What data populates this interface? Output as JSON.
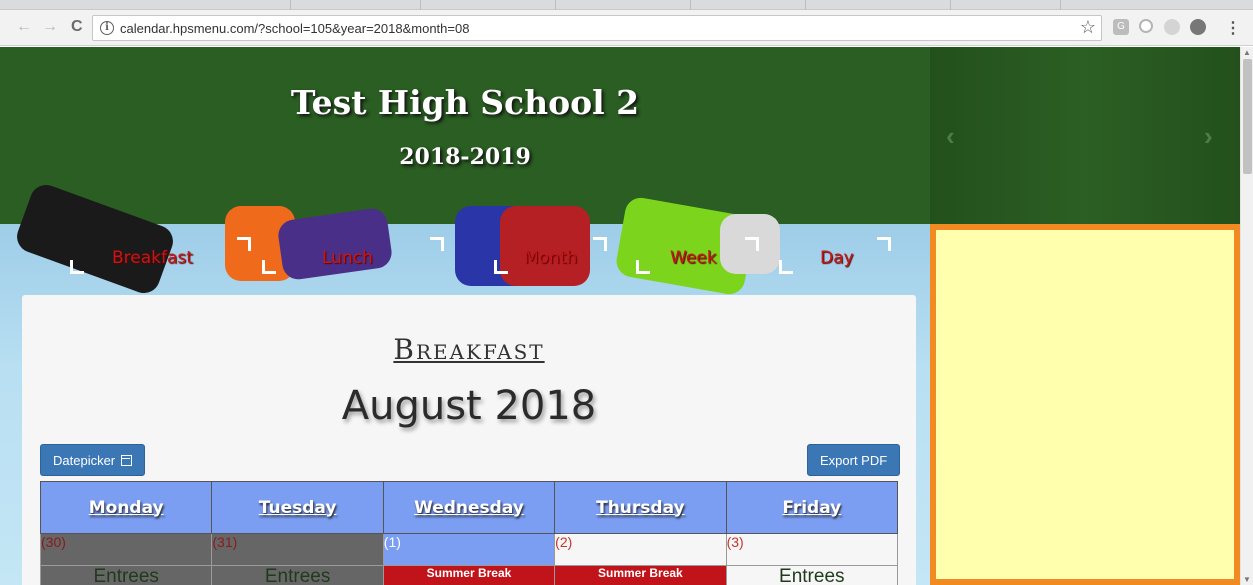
{
  "browser": {
    "url": "calendar.hpsmenu.com/?school=105&year=2018&month=08",
    "back_icon": "←",
    "forward_icon": "→",
    "reload_icon": "C",
    "info_icon": "i",
    "star_icon": "☆",
    "menu_icon": "⋮"
  },
  "header": {
    "school_name": "Test High School 2",
    "school_year": "2018-2019",
    "prev_arrow": "‹",
    "next_arrow": "›"
  },
  "tabs": [
    "Breakfast",
    "Lunch",
    "Month",
    "Week",
    "Day"
  ],
  "calendar": {
    "meal": "Breakfast",
    "month_title": "August 2018",
    "datepicker_label": "Datepicker",
    "export_label": "Export PDF",
    "days": [
      "Monday",
      "Tuesday",
      "Wednesday",
      "Thursday",
      "Friday"
    ],
    "day_numbers": [
      "(30)",
      "(31)",
      "(1)",
      "(2)",
      "(3)"
    ],
    "entries": [
      "Entrees",
      "Entrees",
      "Summer Break",
      "Summer Break",
      "Entrees"
    ]
  },
  "colors": {
    "header_green": "#2a5e22",
    "day_header_blue": "#7b9ef3",
    "break_red": "#c0141a",
    "side_border_orange": "#f28a22",
    "side_fill_yellow": "#ffffad",
    "button_blue": "#3a77b4"
  }
}
